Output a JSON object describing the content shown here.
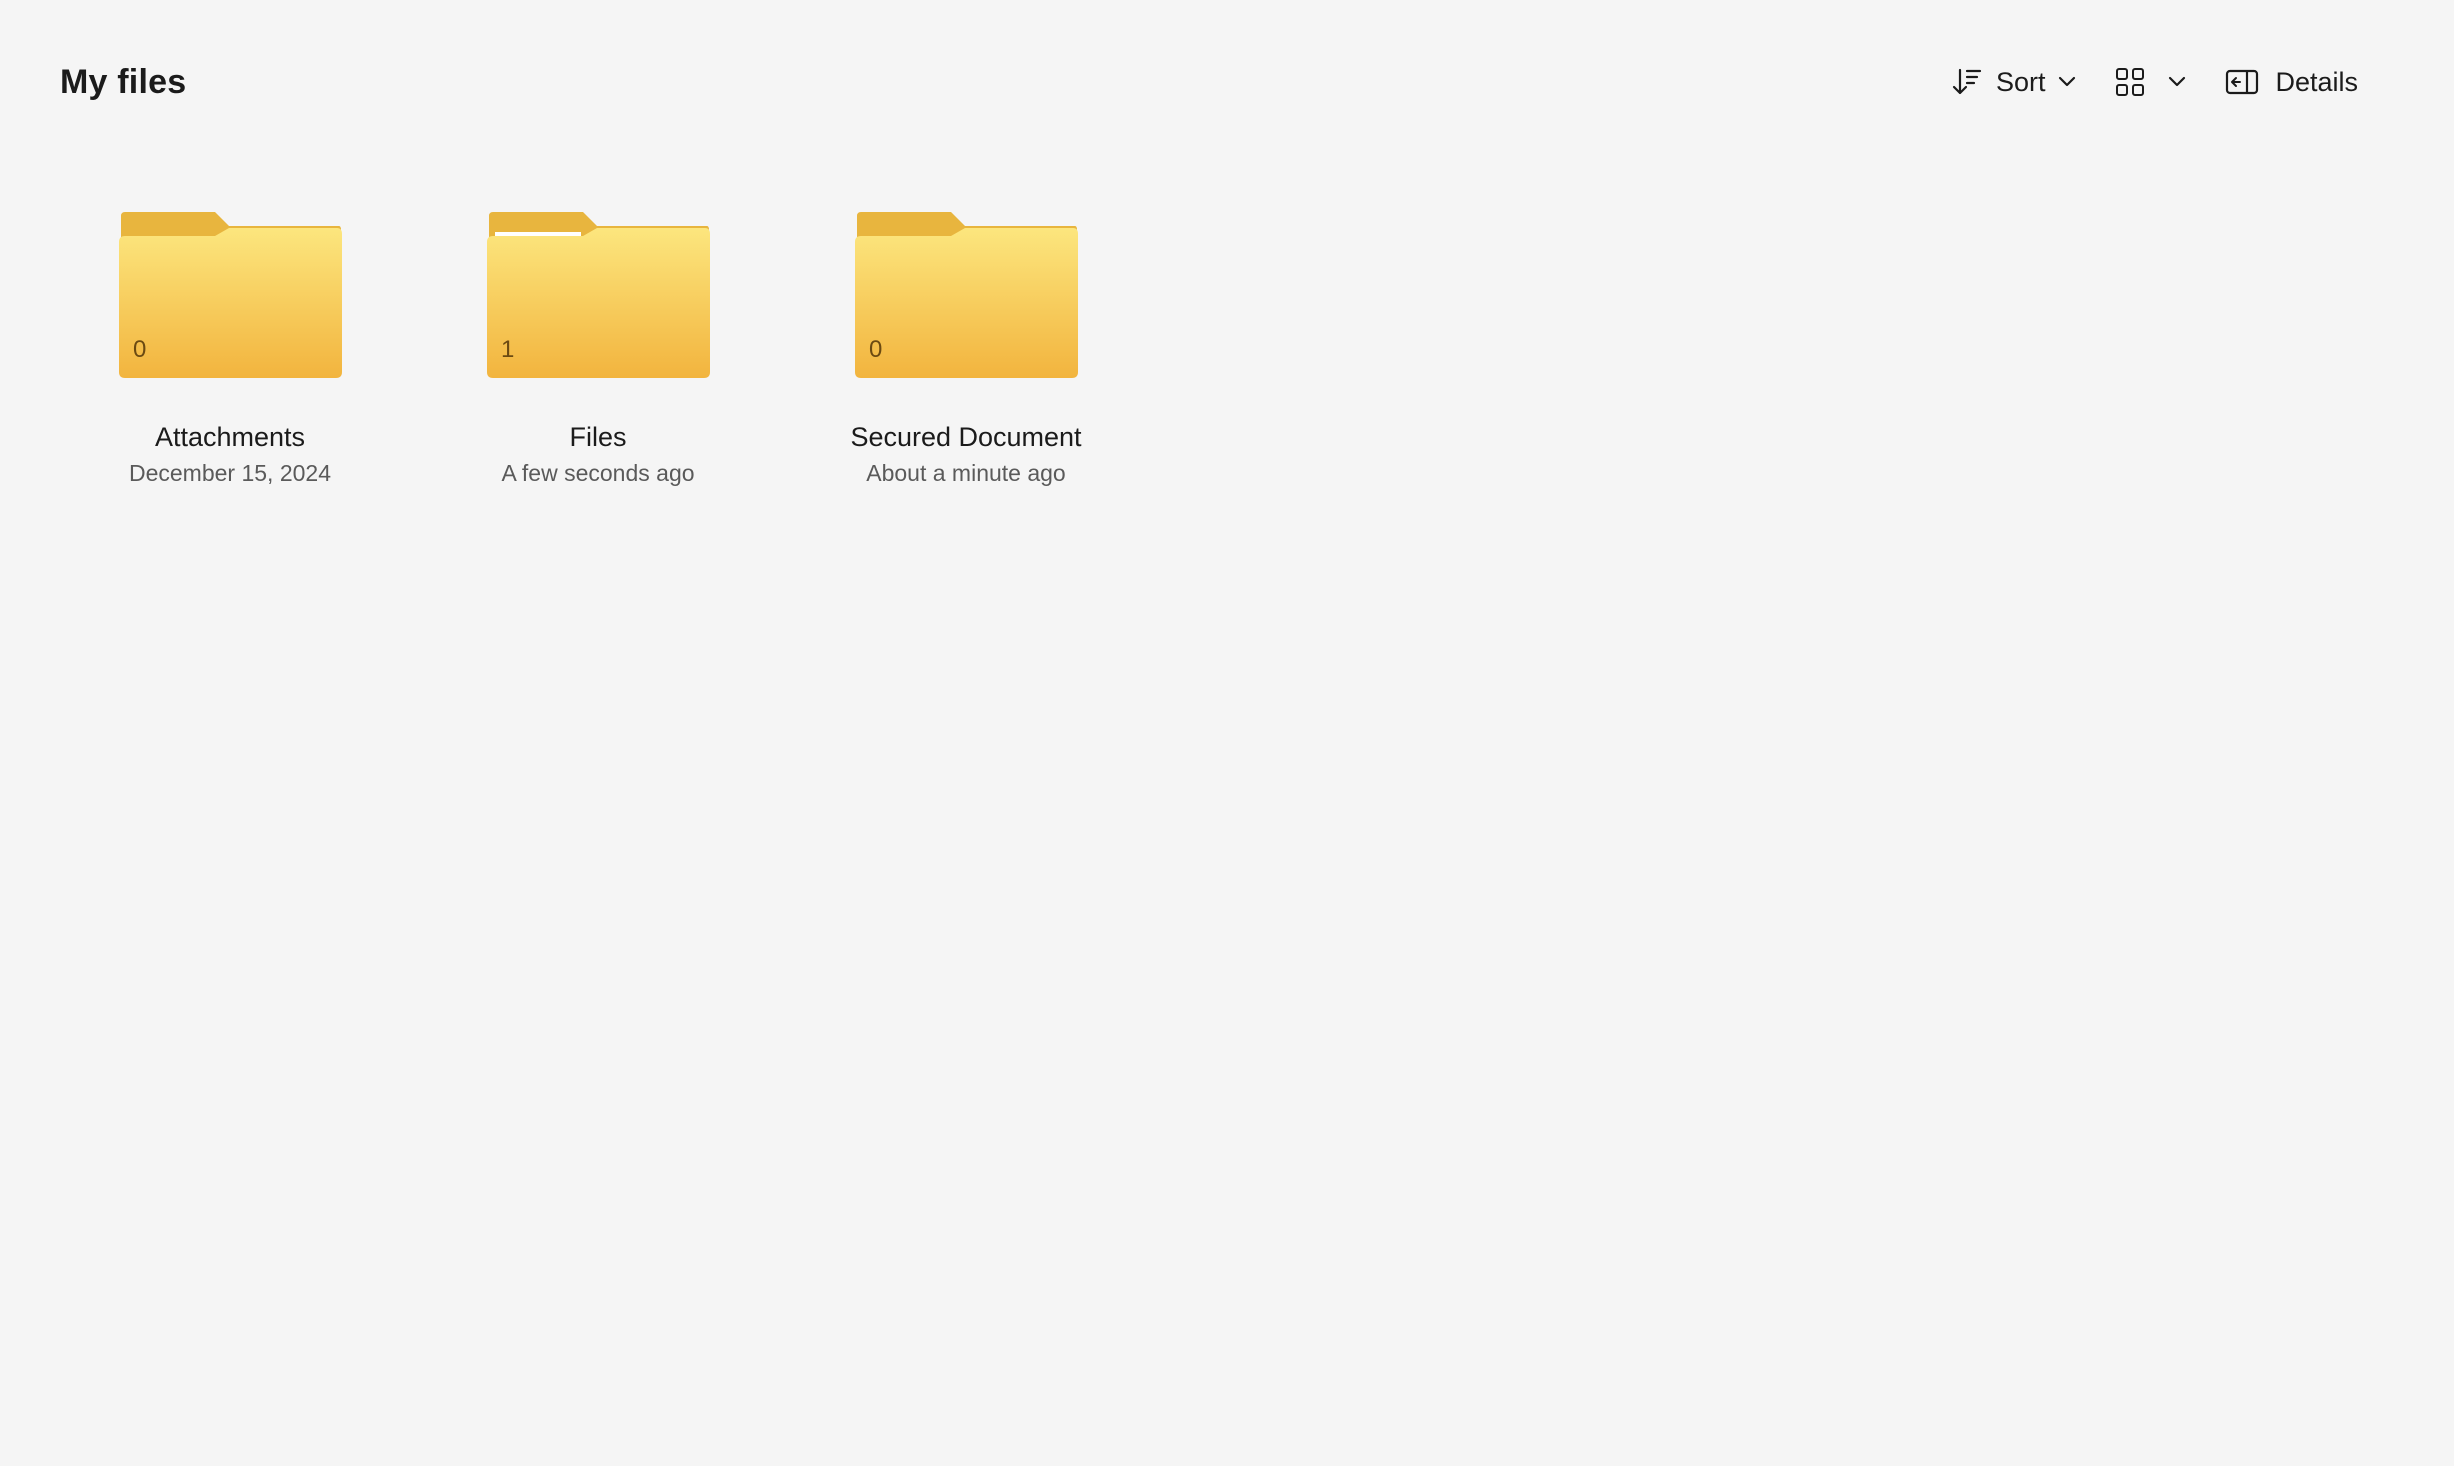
{
  "header": {
    "title": "My files"
  },
  "toolbar": {
    "sort_label": "Sort",
    "details_label": "Details",
    "icons": {
      "sort": "sort-descending-icon",
      "view": "grid-view-icon",
      "chevron": "chevron-down-icon",
      "details": "details-pane-icon"
    }
  },
  "folders": [
    {
      "name": "Attachments",
      "date": "December 15, 2024",
      "count": "0",
      "has_content": false
    },
    {
      "name": "Files",
      "date": "A few seconds ago",
      "count": "1",
      "has_content": true
    },
    {
      "name": "Secured Document",
      "date": "About a minute ago",
      "count": "0",
      "has_content": false
    }
  ],
  "colors": {
    "background": "#f5f5f5",
    "folder_tab": "#e8b53e",
    "folder_front_top": "#fbe27a",
    "folder_front_bottom": "#f2b640"
  }
}
